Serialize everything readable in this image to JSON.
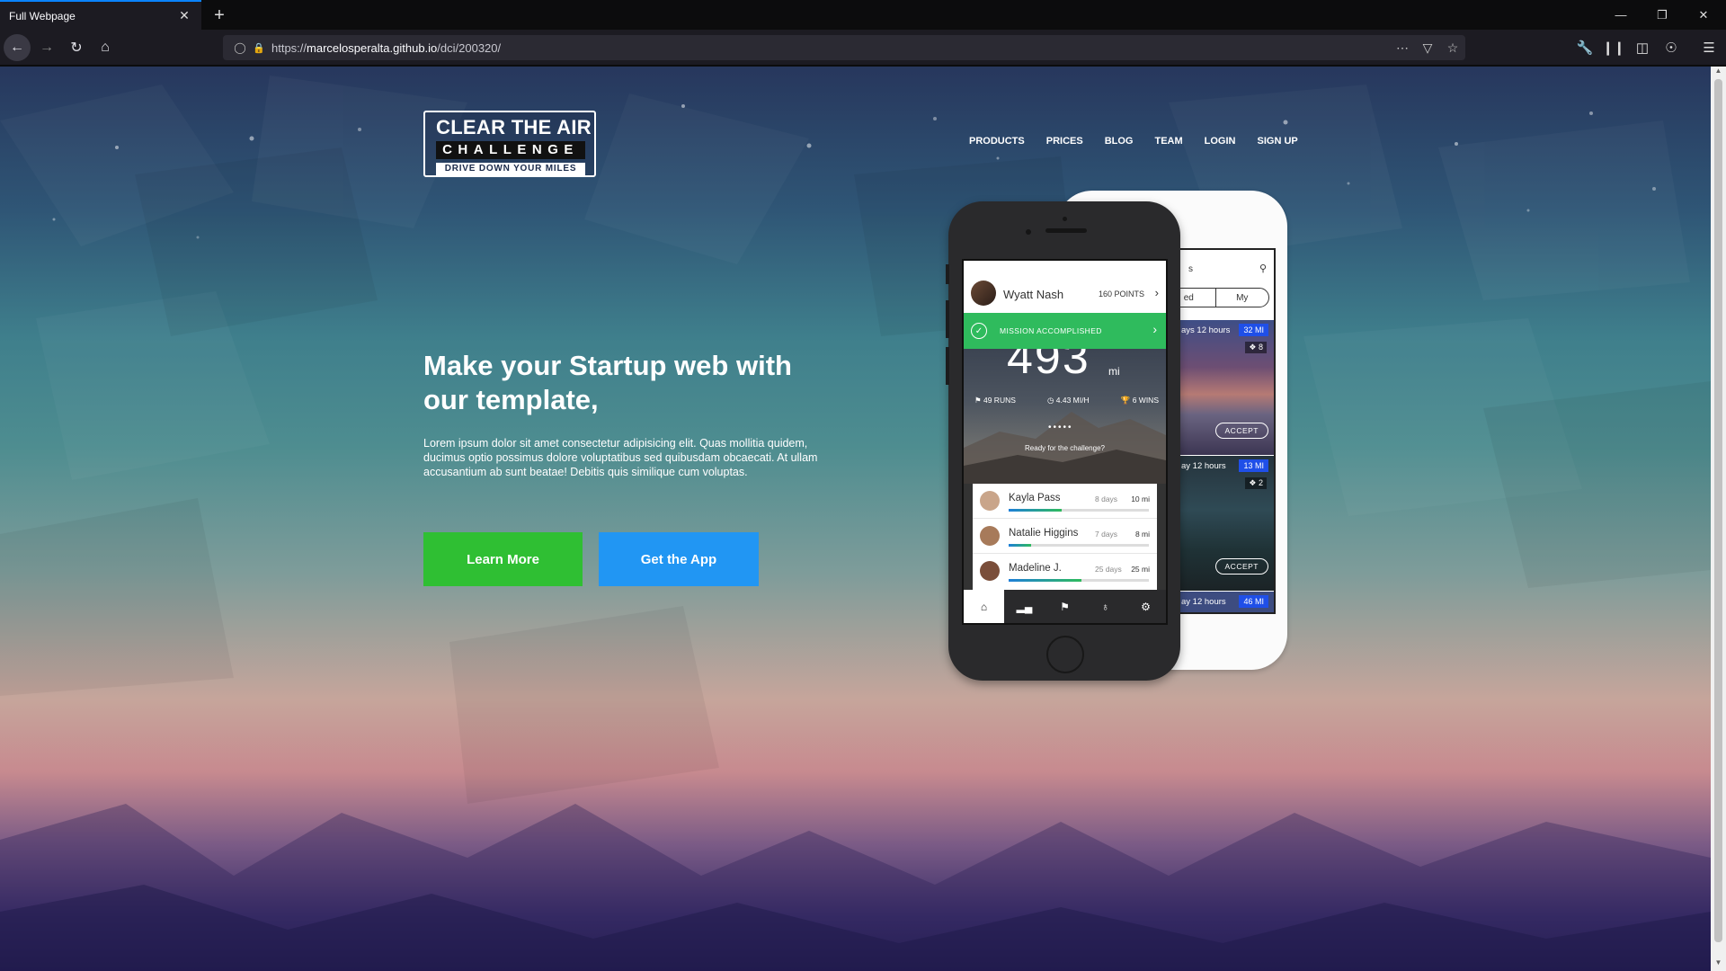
{
  "browser": {
    "tab_title": "Full Webpage",
    "tab_close": "✕",
    "new_tab": "+",
    "url_prefix": "https://",
    "url_host": "marcelosperalta.github.io",
    "url_path": "/dci/200320/",
    "icons": [
      "back-arrow",
      "forward-arrow",
      "reload",
      "home",
      "shield",
      "lock",
      "page-actions",
      "pocket",
      "bookmark-star",
      "tools-wrench",
      "library",
      "sidebar",
      "account",
      "menu"
    ]
  },
  "site": {
    "logo": {
      "line1": "CLEAR THE AIR",
      "line2": "CHALLENGE",
      "line3": "DRIVE DOWN YOUR MILES"
    },
    "nav": [
      "PRODUCTS",
      "PRICES",
      "BLOG",
      "TEAM",
      "LOGIN",
      "SIGN UP"
    ],
    "hero": {
      "title": "Make your Startup web with our template,",
      "text": "Lorem ipsum dolor sit amet consectetur adipisicing elit. Quas mollitia quidem, ducimus optio possimus dolore voluptatibus sed quibusdam obcaecati. At ullam accusantium ab sunt beatae! Debitis quis similique cum voluptas.",
      "btn_learn": "Learn More",
      "btn_app": "Get the App"
    },
    "colors": {
      "learn": "#2fbf33",
      "app": "#2196f3",
      "mission": "#2fbb5d"
    }
  },
  "phone_back": {
    "search_label": "s",
    "tab_left": "ed",
    "tab_right": "My",
    "cards": [
      {
        "days": "ays 12 hours",
        "miles": "32 MI",
        "people": "8",
        "accept": "ACCEPT"
      },
      {
        "days": "ay 12 hours",
        "miles": "13 MI",
        "people": "2",
        "accept": "ACCEPT"
      },
      {
        "days": "ay 12 hours",
        "miles": "46 MI"
      }
    ]
  },
  "phone_front": {
    "user_name": "Wyatt Nash",
    "points": "160 POINTS",
    "mission": "MISSION ACCOMPLISHED",
    "big_number": "493",
    "unit": "mi",
    "stats": {
      "runs": "49 RUNS",
      "speed": "4.43 MI/H",
      "wins": "6 WINS"
    },
    "ready": "Ready for the challenge?",
    "leaders": [
      {
        "name": "Kayla Pass",
        "days": "8 days",
        "miles": "10 mi",
        "progress": 0.38
      },
      {
        "name": "Natalie Higgins",
        "days": "7 days",
        "miles": "8 mi",
        "progress": 0.16
      },
      {
        "name": "Madeline J.",
        "days": "25 days",
        "miles": "25 mi",
        "progress": 0.52
      }
    ],
    "tabs": [
      "home",
      "stats",
      "flag",
      "person",
      "settings"
    ]
  }
}
